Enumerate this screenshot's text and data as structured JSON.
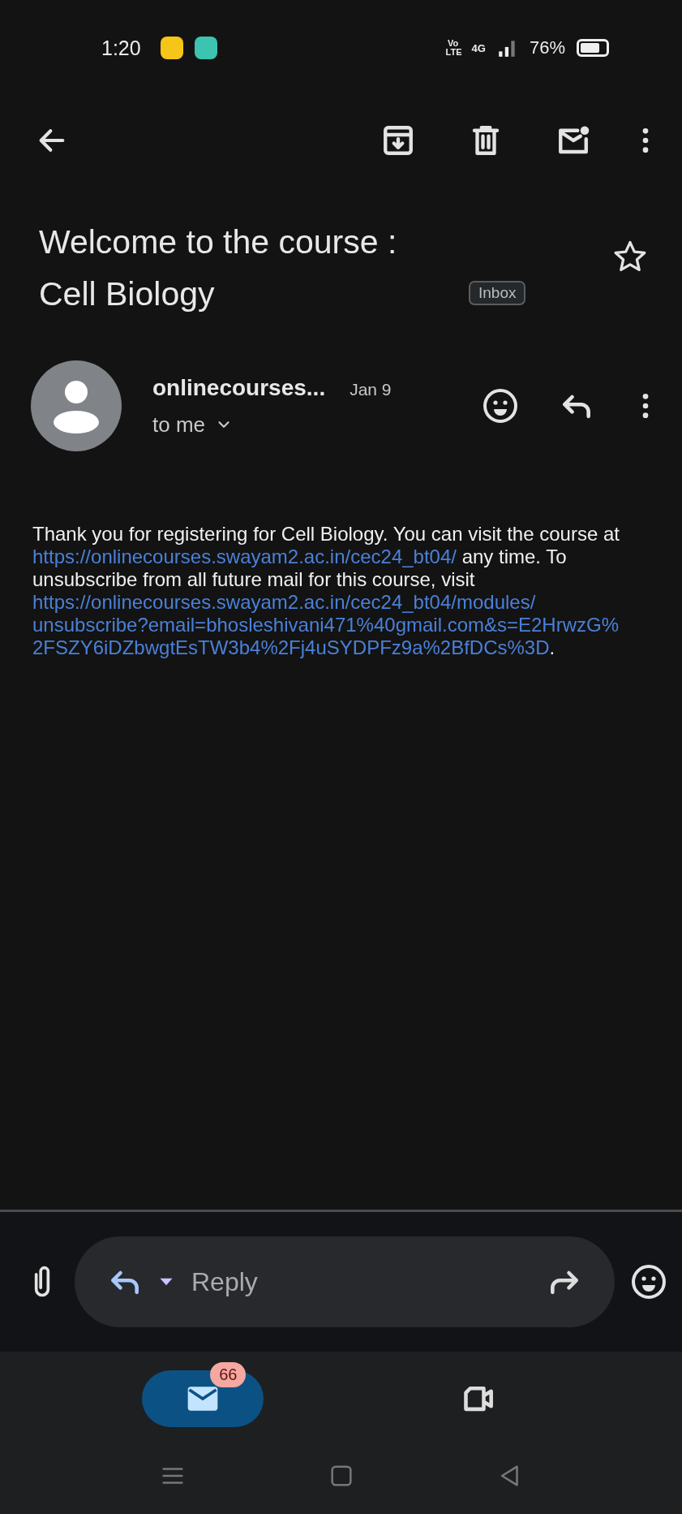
{
  "status_bar": {
    "time": "1:20",
    "volte": "Vo LTE",
    "network": "4G",
    "battery": "76%"
  },
  "subject": {
    "title": "Welcome to the course : Cell Biology",
    "label": "Inbox",
    "starred": false
  },
  "message": {
    "sender": "onlinecourses...",
    "date": "Jan 9",
    "recipient": "to me",
    "body": [
      {
        "kind": "text",
        "text": "Thank you for registering for Cell Biology. You can visit the course at "
      },
      {
        "kind": "link",
        "text": "https://onlinecourses.swayam2.ac.in/cec24_bt04/"
      },
      {
        "kind": "text",
        "text": " any time. To unsubscribe from all future mail for this course, visit "
      },
      {
        "kind": "link",
        "text": "https://onlinecourses.swayam2.ac.in/cec24_bt04/modules/"
      },
      {
        "kind": "link",
        "text": "unsubscribe?email=bhosleshivani471%40gmail.com&s=E2HrwzG%"
      },
      {
        "kind": "link",
        "text": "2FSZY6iDZbwgtEsTW3b4%2Fj4uSYDPFz9a%2BfDCs%3D"
      },
      {
        "kind": "text",
        "text": "."
      }
    ]
  },
  "reply_bar": {
    "placeholder": "Reply"
  },
  "bottom_nav": [
    {
      "kind": "mail",
      "selected": true,
      "badge": "66"
    },
    {
      "kind": "video",
      "selected": false
    }
  ]
}
